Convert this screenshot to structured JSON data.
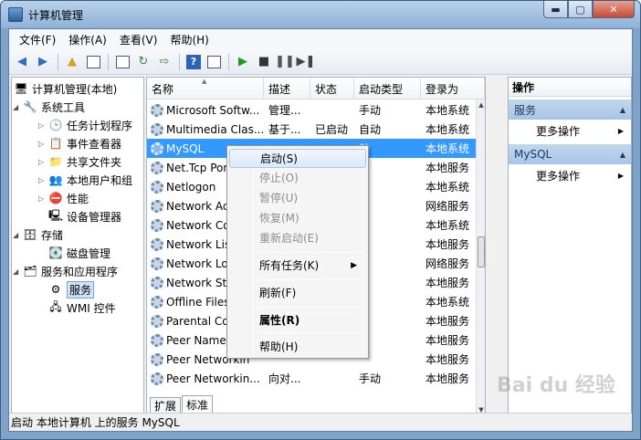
{
  "window": {
    "title": "计算机管理",
    "min": "▬",
    "max": "▢",
    "close": "✕"
  },
  "menu": [
    "文件(F)",
    "操作(A)",
    "查看(V)",
    "帮助(H)"
  ],
  "tree": {
    "root": "计算机管理(本地)",
    "system_tools": "系统工具",
    "task_scheduler": "任务计划程序",
    "event_viewer": "事件查看器",
    "shared_folders": "共享文件夹",
    "local_users": "本地用户和组",
    "performance": "性能",
    "device_manager": "设备管理器",
    "storage": "存储",
    "disk_mgmt": "磁盘管理",
    "services_apps": "服务和应用程序",
    "services": "服务",
    "wmi": "WMI 控件"
  },
  "columns": [
    "名称",
    "描述",
    "状态",
    "启动类型",
    "登录为"
  ],
  "rows": [
    {
      "name": "Microsoft Softw...",
      "desc": "管理...",
      "status": "",
      "startup": "手动",
      "logon": "本地系统"
    },
    {
      "name": "Multimedia Clas...",
      "desc": "基于...",
      "status": "已启动",
      "startup": "自动",
      "logon": "本地系统"
    },
    {
      "name": "MySQL",
      "desc": "",
      "status": "",
      "startup": "动",
      "logon": "本地系统"
    },
    {
      "name": "Net.Tcp Por",
      "desc": "",
      "status": "",
      "startup": "用",
      "logon": "本地服务"
    },
    {
      "name": "Netlogon",
      "desc": "",
      "status": "",
      "startup": "",
      "logon": "本地系统"
    },
    {
      "name": "Network Ac",
      "desc": "",
      "status": "",
      "startup": "",
      "logon": "网络服务"
    },
    {
      "name": "Network Co",
      "desc": "",
      "status": "",
      "startup": "",
      "logon": "本地系统"
    },
    {
      "name": "Network Lis",
      "desc": "",
      "status": "",
      "startup": "",
      "logon": "本地服务"
    },
    {
      "name": "Network Lo",
      "desc": "",
      "status": "",
      "startup": "",
      "logon": "网络服务"
    },
    {
      "name": "Network Sto",
      "desc": "",
      "status": "",
      "startup": "",
      "logon": "本地服务"
    },
    {
      "name": "Offline Files",
      "desc": "",
      "status": "",
      "startup": "",
      "logon": "本地系统"
    },
    {
      "name": "Parental Co",
      "desc": "",
      "status": "",
      "startup": "",
      "logon": "本地服务"
    },
    {
      "name": "Peer Name",
      "desc": "",
      "status": "",
      "startup": "",
      "logon": "本地服务"
    },
    {
      "name": "Peer Networkin",
      "desc": "",
      "status": "",
      "startup": "",
      "logon": "本地服务"
    },
    {
      "name": "Peer Networkin...",
      "desc": "向对...",
      "status": "",
      "startup": "手动",
      "logon": "本地服务"
    }
  ],
  "tabs": [
    "扩展",
    "标准"
  ],
  "actions": {
    "title": "操作",
    "sec1": "服务",
    "more1": "更多操作",
    "sec2": "MySQL",
    "more2": "更多操作"
  },
  "context_menu": {
    "start": "启动(S)",
    "stop": "停止(O)",
    "pause": "暂停(U)",
    "resume": "恢复(M)",
    "restart": "重新启动(E)",
    "all_tasks": "所有任务(K)",
    "refresh": "刷新(F)",
    "properties": "属性(R)",
    "help": "帮助(H)"
  },
  "status": "启动 本地计算机 上的服务 MySQL",
  "watermark": "Bai du 经验"
}
